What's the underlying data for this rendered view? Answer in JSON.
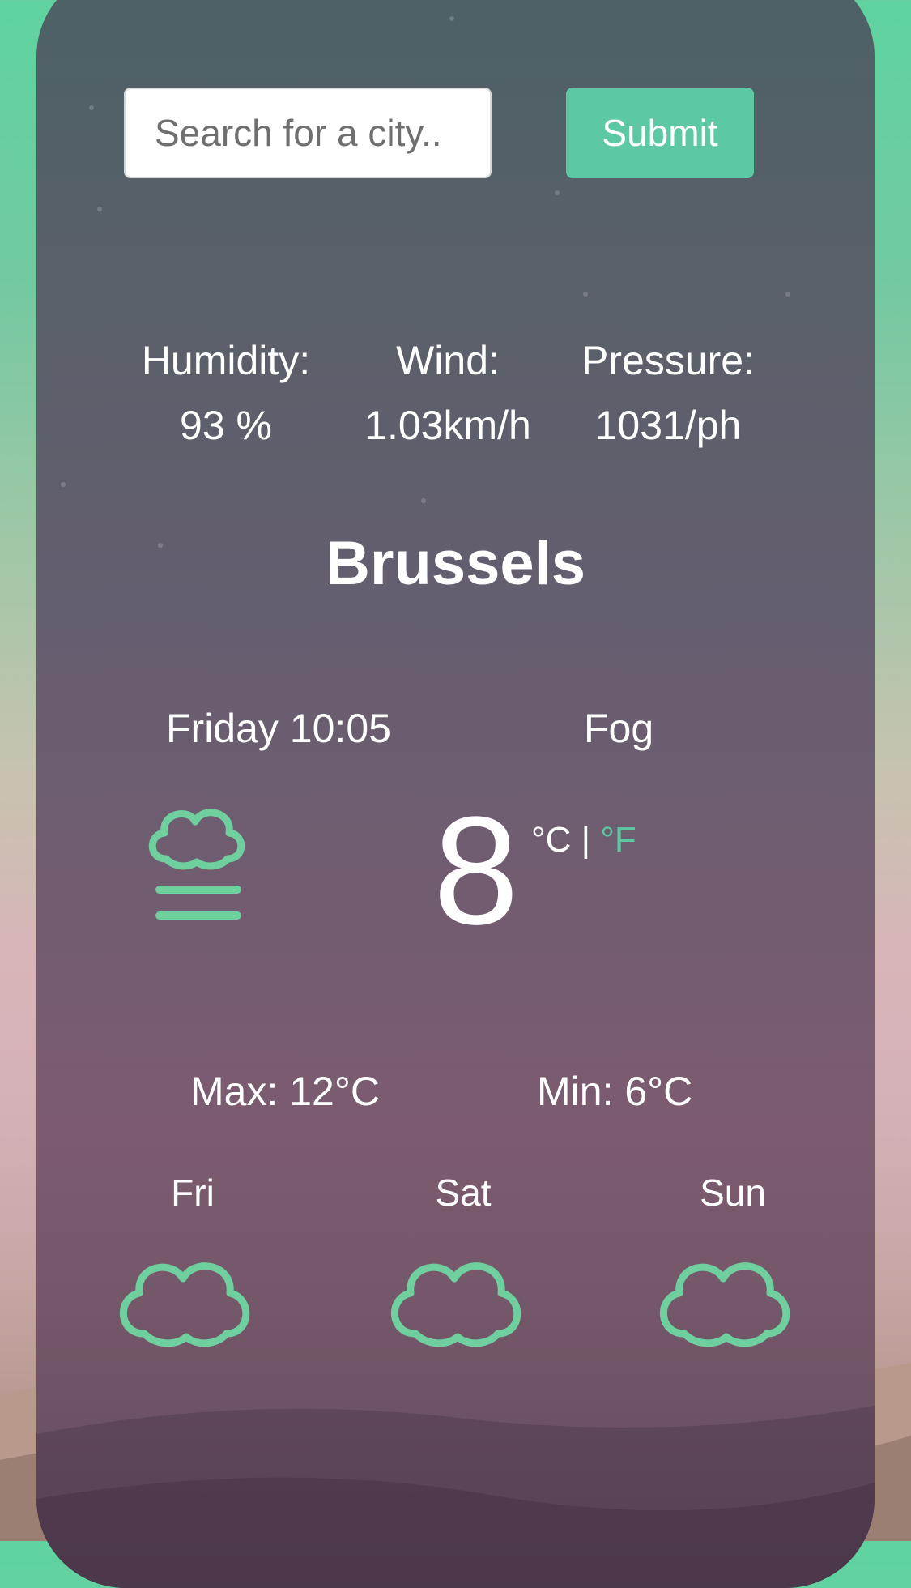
{
  "search": {
    "placeholder": "Search for a city..",
    "value": ""
  },
  "submit_label": "Submit",
  "stats": [
    {
      "label": "Humidity:",
      "value": "93 %"
    },
    {
      "label": "Wind:",
      "value": "1.03km/h"
    },
    {
      "label": "Pressure:",
      "value": "1031/ph"
    }
  ],
  "city": "Brussels",
  "datetime": "Friday 10:05",
  "condition": "Fog",
  "condition_icon": "fog-icon",
  "temperature": "8",
  "units": {
    "celsius": "°C",
    "separator": "|",
    "fahrenheit": "°F"
  },
  "max": "Max: 12°C",
  "min": "Min: 6°C",
  "forecast": [
    {
      "day": "Fri",
      "icon": "cloud-icon"
    },
    {
      "day": "Sat",
      "icon": "cloud-icon"
    },
    {
      "day": "Sun",
      "icon": "cloud-icon"
    }
  ],
  "colors": {
    "accent": "#5cc9a4",
    "text": "#ffffff"
  }
}
